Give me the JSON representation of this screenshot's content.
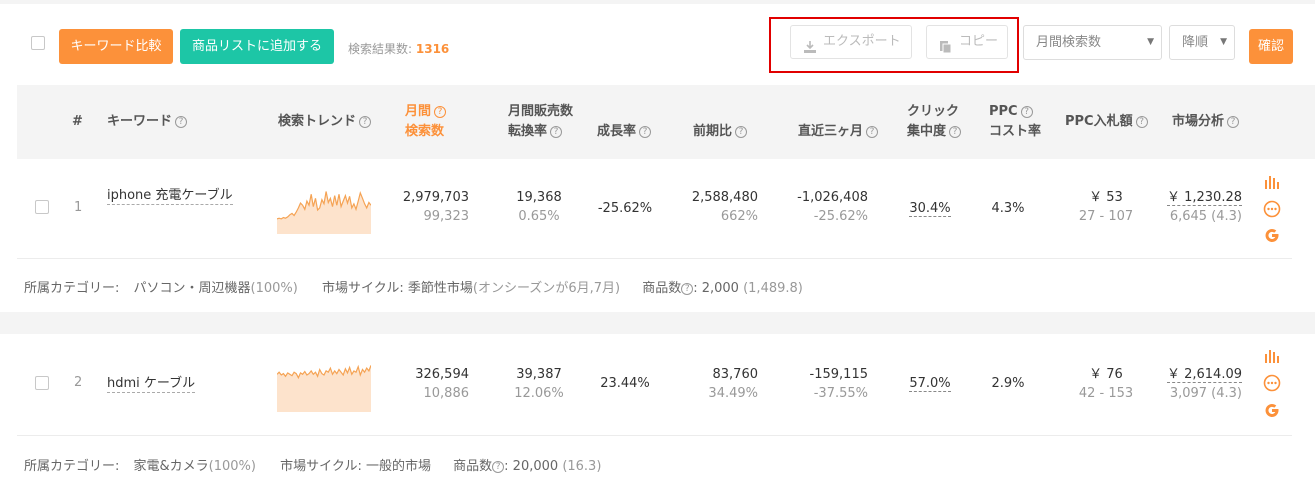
{
  "toolbar": {
    "compare_label": "キーワード比較",
    "add_label": "商品リストに追加する",
    "result_label": "検索結果数:",
    "result_count": "1316",
    "export_label": "エクスポート",
    "copy_label": "コピー",
    "sort_field": "月間検索数",
    "sort_order": "降順",
    "confirm_label": "確認"
  },
  "columns": {
    "index": "#",
    "keyword": "キーワード",
    "trend": "検索トレンド",
    "monthly_1": "月間",
    "monthly_2": "検索数",
    "sales_1": "月間販売数",
    "sales_2": "転換率",
    "growth": "成長率",
    "prev": "前期比",
    "recent": "直近三ヶ月",
    "click_1": "クリック",
    "click_2": "集中度",
    "ppc_1": "PPC",
    "ppc_2": "コスト率",
    "bid": "PPC入札額",
    "market": "市場分析"
  },
  "rows": [
    {
      "index": "1",
      "keyword": "iphone 充電ケーブル",
      "monthly": "2,979,703",
      "monthly_sub": "99,323",
      "sales": "19,368",
      "conversion": "0.65%",
      "growth": "-25.62%",
      "prev": "2,588,480",
      "prev_sub": "662%",
      "recent": "-1,026,408",
      "recent_sub": "-25.62%",
      "click": "30.4%",
      "ppc": "4.3%",
      "bid": "￥ 53",
      "bid_range": "27 - 107",
      "market": "￥ 1,230.28",
      "market_sub": "6,645 (4.3)",
      "cat_label": "所属カテゴリー:",
      "cat_value": "パソコン・周辺機器",
      "cat_pct": "(100%)",
      "cycle_label": "市場サイクル:",
      "cycle_value": "季節性市場",
      "cycle_note": "(オンシーズンが6月,7月)",
      "products_label": "商品数",
      "products_value": ": 2,000",
      "products_sub": "(1,489.8)",
      "trend": [
        22,
        23,
        22,
        24,
        23,
        25,
        28,
        30,
        27,
        32,
        38,
        45,
        42,
        36,
        48,
        42,
        58,
        40,
        52,
        35,
        38,
        50,
        44,
        62,
        46,
        52,
        40,
        56,
        42,
        58,
        40,
        48,
        56,
        45,
        55,
        38,
        44,
        36,
        48,
        60,
        52,
        44,
        38,
        46,
        42
      ]
    },
    {
      "index": "2",
      "keyword": "hdmi ケーブル",
      "monthly": "326,594",
      "monthly_sub": "10,886",
      "sales": "39,387",
      "conversion": "12.06%",
      "growth": "23.44%",
      "prev": "83,760",
      "prev_sub": "34.49%",
      "recent": "-159,115",
      "recent_sub": "-37.55%",
      "click": "57.0%",
      "ppc": "2.9%",
      "bid": "￥ 76",
      "bid_range": "42 - 153",
      "market": "￥ 2,614.09",
      "market_sub": "3,097 (4.3)",
      "cat_label": "所属カテゴリー:",
      "cat_value": "家電&カメラ",
      "cat_pct": "(100%)",
      "cycle_label": "市場サイクル:",
      "cycle_value": "一般的市場",
      "cycle_note": "",
      "products_label": "商品数",
      "products_value": ": 20,000",
      "products_sub": "(16.3)",
      "trend": [
        55,
        58,
        54,
        56,
        52,
        57,
        55,
        53,
        58,
        56,
        50,
        57,
        55,
        59,
        54,
        56,
        60,
        55,
        58,
        52,
        62,
        56,
        54,
        60,
        58,
        64,
        55,
        60,
        56,
        62,
        58,
        54,
        63,
        57,
        65,
        55,
        60,
        58,
        66,
        54,
        62,
        58,
        64,
        60,
        68
      ]
    }
  ],
  "colors": {
    "accent": "#fc913a",
    "green": "#1dc6a6",
    "highlight": "#e10000"
  }
}
